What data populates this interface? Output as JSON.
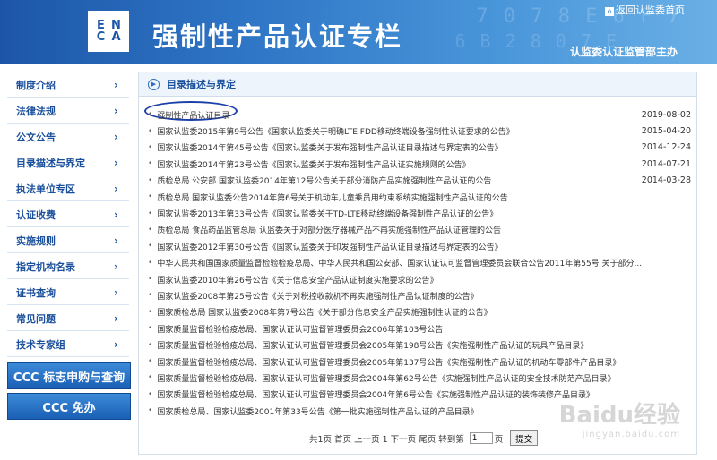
{
  "banner": {
    "logo_letters": [
      "E",
      "N",
      "C",
      "A"
    ],
    "title": "强制性产品认证专栏",
    "home_link": "返回认监委首页",
    "subtitle": "认监委认证监管部主办",
    "decor_1": "7 0 7 8 E 6 F 7",
    "decor_2": "6 B 2 8 0 7 E",
    "brand_color": "#1d56a8"
  },
  "sidebar": {
    "items": [
      {
        "label": "制度介绍"
      },
      {
        "label": "法律法规"
      },
      {
        "label": "公文公告"
      },
      {
        "label": "目录描述与界定"
      },
      {
        "label": "执法单位专区"
      },
      {
        "label": "认证收费"
      },
      {
        "label": "实施规则"
      },
      {
        "label": "指定机构名录"
      },
      {
        "label": "证书查询"
      },
      {
        "label": "常见问题"
      },
      {
        "label": "技术专家组"
      }
    ],
    "chevron": "›",
    "ccc_query": "CCC 标志申购与查询",
    "ccc_free": "CCC 免办"
  },
  "section": {
    "title": "目录描述与界定",
    "items": [
      {
        "text": "强制性产品认证目录",
        "date": "2019-08-02"
      },
      {
        "text": "国家认监委2015年第9号公告《国家认监委关于明确LTE FDD移动终端设备强制性认证要求的公告》",
        "date": "2015-04-20"
      },
      {
        "text": "国家认监委2014年第45号公告《国家认监委关于发布强制性产品认证目录描述与界定表的公告》",
        "date": "2014-12-24"
      },
      {
        "text": "国家认监委2014年第23号公告《国家认监委关于发布强制性产品认证实施规则的公告》",
        "date": "2014-07-21"
      },
      {
        "text": "质检总局 公安部 国家认监委2014年第12号公告关于部分消防产品实施强制性产品认证的公告",
        "date": "2014-03-28"
      },
      {
        "text": "质检总局 国家认监委公告2014年第6号关于机动车儿童乘员用约束系统实施强制性产品认证的公告",
        "date": ""
      },
      {
        "text": "国家认监委2013年第33号公告《国家认监委关于TD-LTE移动终端设备强制性产品认证的公告》",
        "date": ""
      },
      {
        "text": "质检总局 食品药品监管总局 认监委关于对部分医疗器械产品不再实施强制性产品认证管理的公告",
        "date": ""
      },
      {
        "text": "国家认监委2012年第30号公告《国家认监委关于印发强制性产品认证目录描述与界定表的公告》",
        "date": ""
      },
      {
        "text": "中华人民共和国国家质量监督检验检疫总局、中华人民共和国公安部、国家认证认可监督管理委员会联合公告2011年第55号 关于部分...",
        "date": ""
      },
      {
        "text": "国家认监委2010年第26号公告《关于信息安全产品认证制度实施要求的公告》",
        "date": ""
      },
      {
        "text": "国家认监委2008年第25号公告《关于对税控收款机不再实施强制性产品认证制度的公告》",
        "date": ""
      },
      {
        "text": "国家质检总局 国家认监委2008年第7号公告《关于部分信息安全产品实施强制性认证的公告》",
        "date": ""
      },
      {
        "text": "国家质量监督检验检疫总局、国家认证认可监督管理委员会2006年第103号公告",
        "date": ""
      },
      {
        "text": "国家质量监督检验检疫总局、国家认证认可监督管理委员会2005年第198号公告《实施强制性产品认证的玩具产品目录》",
        "date": ""
      },
      {
        "text": "国家质量监督检验检疫总局、国家认证认可监督管理委员会2005年第137号公告《实施强制性产品认证的机动车零部件产品目录》",
        "date": ""
      },
      {
        "text": "国家质量监督检验检疫总局、国家认证认可监督管理委员会2004年第62号公告《实施强制性产品认证的安全技术防范产品目录》",
        "date": ""
      },
      {
        "text": "国家质量监督检验检疫总局、国家认证认可监督管理委员会2004年第6号公告《实施强制性产品认证的装饰装修产品目录》",
        "date": ""
      },
      {
        "text": "国家质检总局、国家认监委2001年第33号公告《第一批实施强制性产品认证的产品目录》",
        "date": ""
      }
    ]
  },
  "pager": {
    "summary": "共1页 首页 上一页 1 下一页 尾页 转到第",
    "page_value": "1",
    "page_suffix": "页",
    "submit": "提交"
  },
  "watermark": {
    "main": "Baidu经验",
    "sub": "jingyan.baidu.com"
  }
}
